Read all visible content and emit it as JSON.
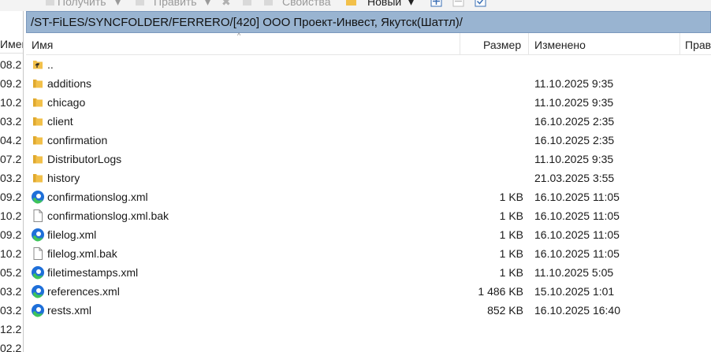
{
  "toolbar": {
    "get_label": "Получить",
    "edit_label": "Править",
    "props_label": "Свойства",
    "new_label": "Новый"
  },
  "left_panel": {
    "header": "Имен",
    "dates": [
      "08.2",
      "09.2",
      "10.2",
      "03.2",
      "04.2",
      "07.2",
      "03.2",
      "09.2",
      "10.2",
      "09.2",
      "10.2",
      "05.2",
      "03.2",
      "03.2",
      "12.2",
      "02.2"
    ]
  },
  "path": "/ST-FiLES/SYNCFOLDER/FERRERO/[420] ООО Проект-Инвест, Якутск(Шаттл)/",
  "columns": {
    "name": "Имя",
    "size": "Размер",
    "modified": "Изменено",
    "rights": "Прав"
  },
  "colors": {
    "path_bar": "#99b4d1",
    "folder": "#f2c04a",
    "edge_blue": "#1e6fd9",
    "edge_green": "#3ec45a"
  },
  "files": [
    {
      "name": "..",
      "type": "up",
      "size": "",
      "modified": ""
    },
    {
      "name": "additions",
      "type": "folder",
      "size": "",
      "modified": "11.10.2025 9:35"
    },
    {
      "name": "chicago",
      "type": "folder",
      "size": "",
      "modified": "11.10.2025 9:35"
    },
    {
      "name": "client",
      "type": "folder",
      "size": "",
      "modified": "16.10.2025 2:35"
    },
    {
      "name": "confirmation",
      "type": "folder",
      "size": "",
      "modified": "16.10.2025 2:35"
    },
    {
      "name": "DistributorLogs",
      "type": "folder",
      "size": "",
      "modified": "11.10.2025 9:35"
    },
    {
      "name": "history",
      "type": "folder",
      "size": "",
      "modified": "21.03.2025 3:55"
    },
    {
      "name": "confirmationslog.xml",
      "type": "edge",
      "size": "1 KB",
      "modified": "16.10.2025 11:05"
    },
    {
      "name": "confirmationslog.xml.bak",
      "type": "file",
      "size": "1 KB",
      "modified": "16.10.2025 11:05"
    },
    {
      "name": "filelog.xml",
      "type": "edge",
      "size": "1 KB",
      "modified": "16.10.2025 11:05"
    },
    {
      "name": "filelog.xml.bak",
      "type": "file",
      "size": "1 KB",
      "modified": "16.10.2025 11:05"
    },
    {
      "name": "filetimestamps.xml",
      "type": "edge",
      "size": "1 KB",
      "modified": "11.10.2025 5:05"
    },
    {
      "name": "references.xml",
      "type": "edge",
      "size": "1 486 KB",
      "modified": "15.10.2025 1:01"
    },
    {
      "name": "rests.xml",
      "type": "edge",
      "size": "852 KB",
      "modified": "16.10.2025 16:40"
    }
  ]
}
